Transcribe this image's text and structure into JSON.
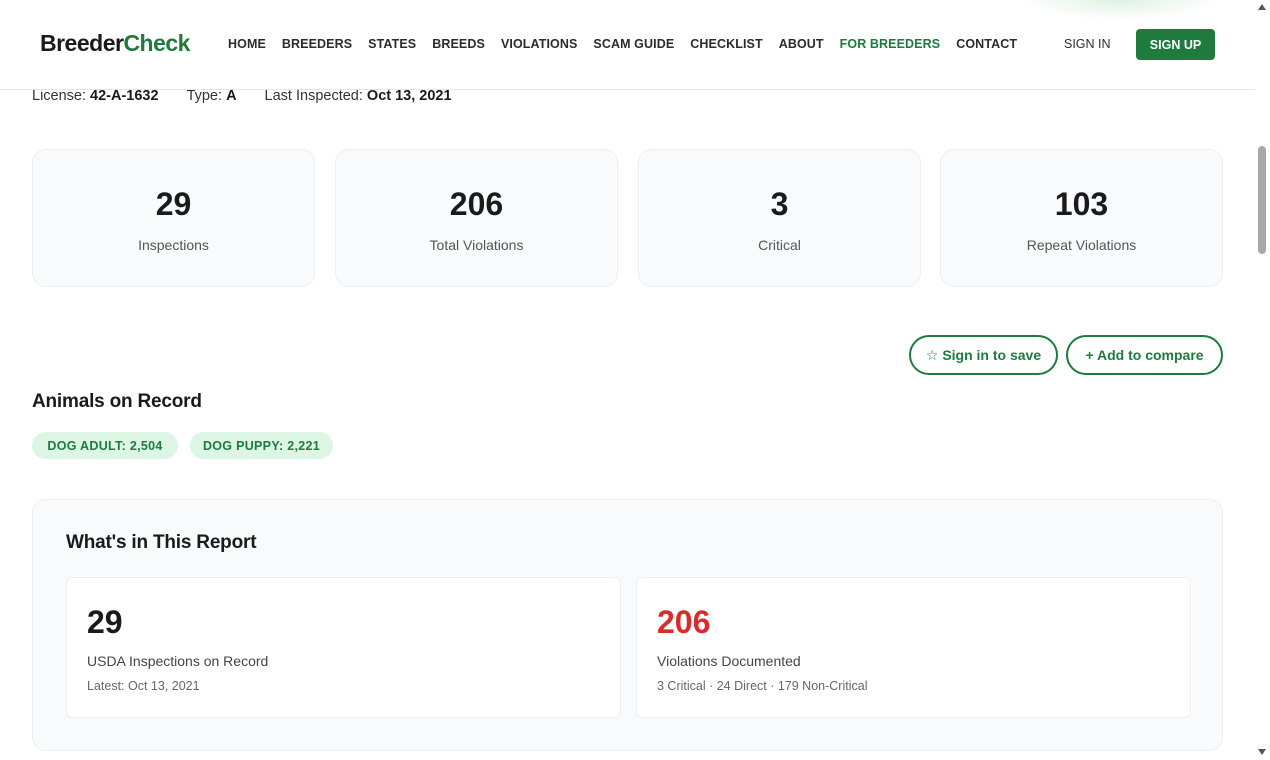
{
  "header": {
    "logo_part1": "Breeder",
    "logo_part2": "Check",
    "nav": [
      {
        "label": "HOME"
      },
      {
        "label": "BREEDERS"
      },
      {
        "label": "STATES"
      },
      {
        "label": "BREEDS"
      },
      {
        "label": "VIOLATIONS"
      },
      {
        "label": "SCAM GUIDE"
      },
      {
        "label": "CHECKLIST"
      },
      {
        "label": "ABOUT"
      },
      {
        "label": "FOR BREEDERS"
      },
      {
        "label": "CONTACT"
      }
    ],
    "active_nav": "FOR BREEDERS",
    "sign_in": "SIGN IN",
    "sign_up": "SIGN UP"
  },
  "license": {
    "license_label": "License:",
    "license_value": "42-A-1632",
    "type_label": "Type:",
    "type_value": "A",
    "inspected_label": "Last Inspected:",
    "inspected_value": "Oct 13, 2021"
  },
  "stats": [
    {
      "value": "29",
      "label": "Inspections"
    },
    {
      "value": "206",
      "label": "Total Violations"
    },
    {
      "value": "3",
      "label": "Critical"
    },
    {
      "value": "103",
      "label": "Repeat Violations"
    }
  ],
  "actions": {
    "save": "☆ Sign in to save",
    "compare": "+ Add to compare"
  },
  "animals": {
    "title": "Animals on Record",
    "chips": [
      {
        "label": "DOG ADULT: 2,504"
      },
      {
        "label": "DOG PUPPY: 2,221"
      }
    ]
  },
  "report": {
    "title": "What's in This Report",
    "cards": [
      {
        "value": "29",
        "title": "USDA Inspections on Record",
        "sub": "Latest: Oct 13, 2021"
      },
      {
        "value": "206",
        "title": "Violations Documented",
        "sub": "3 Critical · 24 Direct · 179 Non-Critical"
      }
    ]
  },
  "colors": {
    "brand": "#1f7a3e",
    "danger": "#d92b2b",
    "chip_bg": "#dcf5e4"
  }
}
